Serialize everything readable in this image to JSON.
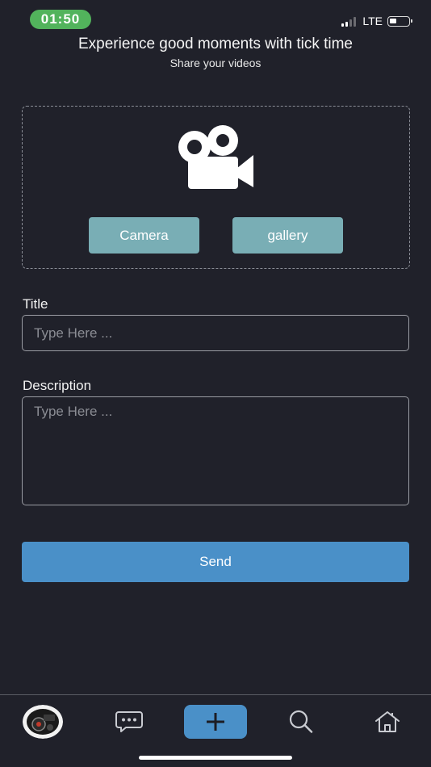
{
  "status_bar": {
    "time": "01:50",
    "network": "LTE",
    "time_pill_color": "#52b35c"
  },
  "header": {
    "title": "Experience good moments with tick time",
    "subtitle": "Share your videos"
  },
  "upload": {
    "icon": "video-camera-icon",
    "camera_label": "Camera",
    "gallery_label": "gallery",
    "button_color": "#79aeb5"
  },
  "form": {
    "title_label": "Title",
    "title_placeholder": "Type Here ...",
    "title_value": "",
    "description_label": "Description",
    "description_placeholder": "Type Here ...",
    "description_value": "",
    "send_label": "Send",
    "send_color": "#4a90c8"
  },
  "tab_bar": {
    "items": [
      {
        "name": "profile",
        "icon": "avatar"
      },
      {
        "name": "messages",
        "icon": "chat-bubble-icon"
      },
      {
        "name": "add",
        "icon": "plus-icon",
        "active": true
      },
      {
        "name": "search",
        "icon": "search-icon"
      },
      {
        "name": "home",
        "icon": "home-icon"
      }
    ]
  },
  "colors": {
    "background": "#20212a",
    "accent": "#4a90c8"
  }
}
